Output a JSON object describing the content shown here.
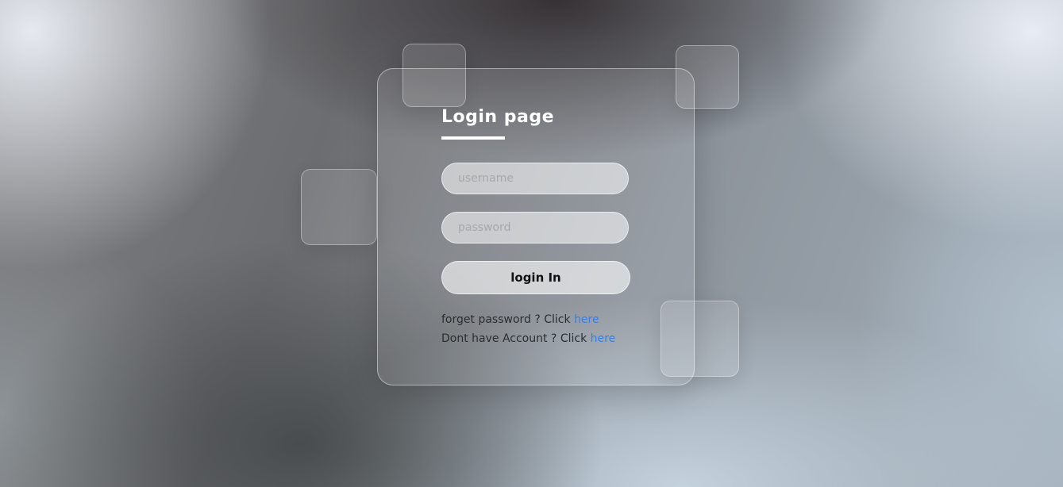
{
  "login": {
    "title": "Login page",
    "username_placeholder": "username",
    "password_placeholder": "password",
    "button_label": "login In",
    "forgot_text": "forget password ? Click ",
    "forgot_link": "here",
    "signup_text": "Dont have Account ? Click ",
    "signup_link": "here"
  },
  "colors": {
    "link": "#3b7de2",
    "title": "#ffffff"
  }
}
